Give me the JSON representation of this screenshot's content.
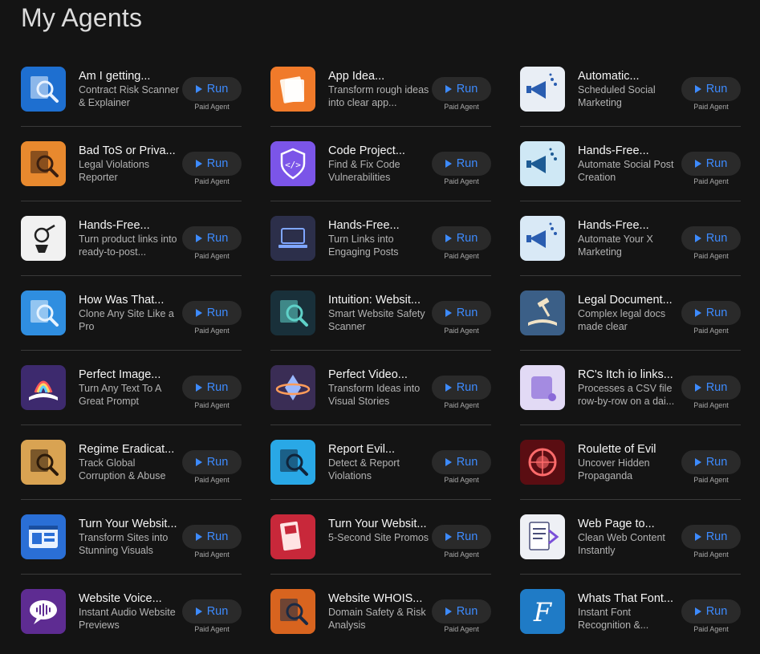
{
  "page": {
    "title": "My Agents"
  },
  "run_label": "Run",
  "paid_label": "Paid Agent",
  "agents": [
    {
      "name": "Am I getting...",
      "desc": "Contract Risk Scanner & Explainer",
      "icon": "contract-scanner-icon",
      "bg": "#1e6fd0",
      "fg": "#e8f2ff"
    },
    {
      "name": "App Idea...",
      "desc": "Transform rough ideas into clear app...",
      "icon": "papers-icon",
      "bg": "#f07a2a",
      "fg": "#fff3e6"
    },
    {
      "name": "Automatic...",
      "desc": "Scheduled Social Marketing",
      "icon": "megaphone-icon",
      "bg": "#e9eef5",
      "fg": "#2a5db0"
    },
    {
      "name": "Bad ToS or Priva...",
      "desc": "Legal Violations Reporter",
      "icon": "document-magnifier-icon",
      "bg": "#e8892e",
      "fg": "#3a1f10"
    },
    {
      "name": "Code Project...",
      "desc": "Find & Fix Code Vulnerabilities",
      "icon": "code-shield-icon",
      "bg": "#7b55e8",
      "fg": "#ffffff"
    },
    {
      "name": "Hands-Free...",
      "desc": "Automate Social Post Creation",
      "icon": "megaphone-icon",
      "bg": "#cfe8f5",
      "fg": "#1d5b94"
    },
    {
      "name": "Hands-Free...",
      "desc": "Turn product links into ready-to-post...",
      "icon": "robot-link-icon",
      "bg": "#f1f1f1",
      "fg": "#222222"
    },
    {
      "name": "Hands-Free...",
      "desc": "Turn Links into Engaging Posts",
      "icon": "laptop-icon",
      "bg": "#2c2f4a",
      "fg": "#7fa6ff"
    },
    {
      "name": "Hands-Free...",
      "desc": "Automate Your X Marketing",
      "icon": "megaphone-icon",
      "bg": "#d9e9f6",
      "fg": "#2a5db0"
    },
    {
      "name": "How Was That...",
      "desc": "Clone Any Site Like a Pro",
      "icon": "clone-magnifier-icon",
      "bg": "#2f8ee0",
      "fg": "#e6f3ff"
    },
    {
      "name": "Intuition: Websit...",
      "desc": "Smart Website Safety Scanner",
      "icon": "magnifier-icon",
      "bg": "#19303a",
      "fg": "#5fd1c8"
    },
    {
      "name": "Legal Document...",
      "desc": "Complex legal docs made clear",
      "icon": "gavel-book-icon",
      "bg": "#3b5f87",
      "fg": "#f0e2c6"
    },
    {
      "name": "Perfect Image...",
      "desc": "Turn Any Text To A Great Prompt",
      "icon": "rainbow-book-icon",
      "bg": "#3d2a6e",
      "fg": "#ffd866"
    },
    {
      "name": "Perfect Video...",
      "desc": "Transform Ideas into Visual Stories",
      "icon": "crystal-orbit-icon",
      "bg": "#3a2d55",
      "fg": "#ff9c5a"
    },
    {
      "name": "RC's Itch io links...",
      "desc": "Processes a CSV file row-by-row on a dai...",
      "icon": "scroll-icon",
      "bg": "#e2daf5",
      "fg": "#8a6ad8"
    },
    {
      "name": "Regime Eradicat...",
      "desc": "Track Global Corruption & Abuse",
      "icon": "magnifier-map-icon",
      "bg": "#d9a352",
      "fg": "#2b1a0a"
    },
    {
      "name": "Report Evil...",
      "desc": "Detect & Report Violations",
      "icon": "magnifier-card-icon",
      "bg": "#29a8e6",
      "fg": "#10243a"
    },
    {
      "name": "Roulette of Evil",
      "desc": "Uncover Hidden Propaganda",
      "icon": "roulette-icon",
      "bg": "#5a0d12",
      "fg": "#ff6b6b"
    },
    {
      "name": "Turn Your Websit...",
      "desc": "Transform Sites into Stunning Visuals",
      "icon": "website-window-icon",
      "bg": "#2a6fd6",
      "fg": "#e9f2ff"
    },
    {
      "name": "Turn Your Websit...",
      "desc": "5-Second Site Promos",
      "icon": "film-strip-icon",
      "bg": "#c8283a",
      "fg": "#ffe4e4"
    },
    {
      "name": "Web Page to...",
      "desc": "Clean Web Content Instantly",
      "icon": "web-document-icon",
      "bg": "#eef0f5",
      "fg": "#4a4f7a"
    },
    {
      "name": "Website Voice...",
      "desc": "Instant Audio Website Previews",
      "icon": "voice-bubble-icon",
      "bg": "#5e2c92",
      "fg": "#ffffff"
    },
    {
      "name": "Website WHOIS...",
      "desc": "Domain Safety & Risk Analysis",
      "icon": "whois-magnifier-icon",
      "bg": "#d8641f",
      "fg": "#1a2a44"
    },
    {
      "name": "Whats That Font...",
      "desc": "Instant Font Recognition &...",
      "icon": "font-letter-icon",
      "bg": "#1f7bc6",
      "fg": "#ffffff"
    }
  ]
}
